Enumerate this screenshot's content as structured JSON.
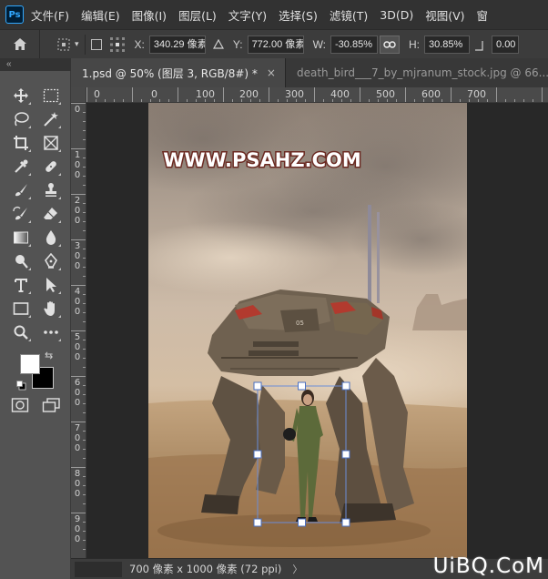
{
  "app": {
    "logo_text": "Ps"
  },
  "menu": {
    "items": [
      "文件(F)",
      "编辑(E)",
      "图像(I)",
      "图层(L)",
      "文字(Y)",
      "选择(S)",
      "滤镜(T)",
      "3D(D)",
      "视图(V)",
      "窗"
    ]
  },
  "options": {
    "x_label": "X:",
    "x_value": "340.29 像素",
    "y_label": "Y:",
    "y_value": "772.00 像素",
    "w_label": "W:",
    "w_value": "-30.85%",
    "h_label": "H:",
    "h_value": "30.85%",
    "angle_value": "0.00"
  },
  "toolbar": {
    "collapse_glyph": "«"
  },
  "tabs": [
    {
      "label": "1.psd @ 50% (图层 3, RGB/8#) *",
      "close": "×"
    },
    {
      "label": "death_bird___7_by_mjranum_stock.jpg @ 66..."
    }
  ],
  "ruler_h": [
    "0",
    "0",
    "100",
    "200",
    "300",
    "400",
    "500",
    "600",
    "700"
  ],
  "ruler_v": [
    [
      "0"
    ],
    [
      "1",
      "0",
      "0"
    ],
    [
      "2",
      "0",
      "0"
    ],
    [
      "3",
      "0",
      "0"
    ],
    [
      "4",
      "0",
      "0"
    ],
    [
      "5",
      "0",
      "0"
    ],
    [
      "6",
      "0",
      "0"
    ],
    [
      "7",
      "0",
      "0"
    ],
    [
      "8",
      "0",
      "0"
    ],
    [
      "9",
      "0",
      "0"
    ]
  ],
  "canvas": {
    "watermark": "WWW.PSAHZ.COM",
    "mech_number": "05"
  },
  "status": {
    "doc_size": "700 像素 x 1000 像素 (72 ppi)",
    "arrow": "〉"
  },
  "overlay": {
    "brand": "UiBQ.CoM"
  },
  "colors": {
    "foreground": "#ffffff",
    "background": "#000000",
    "accent": "#31a8ff"
  }
}
